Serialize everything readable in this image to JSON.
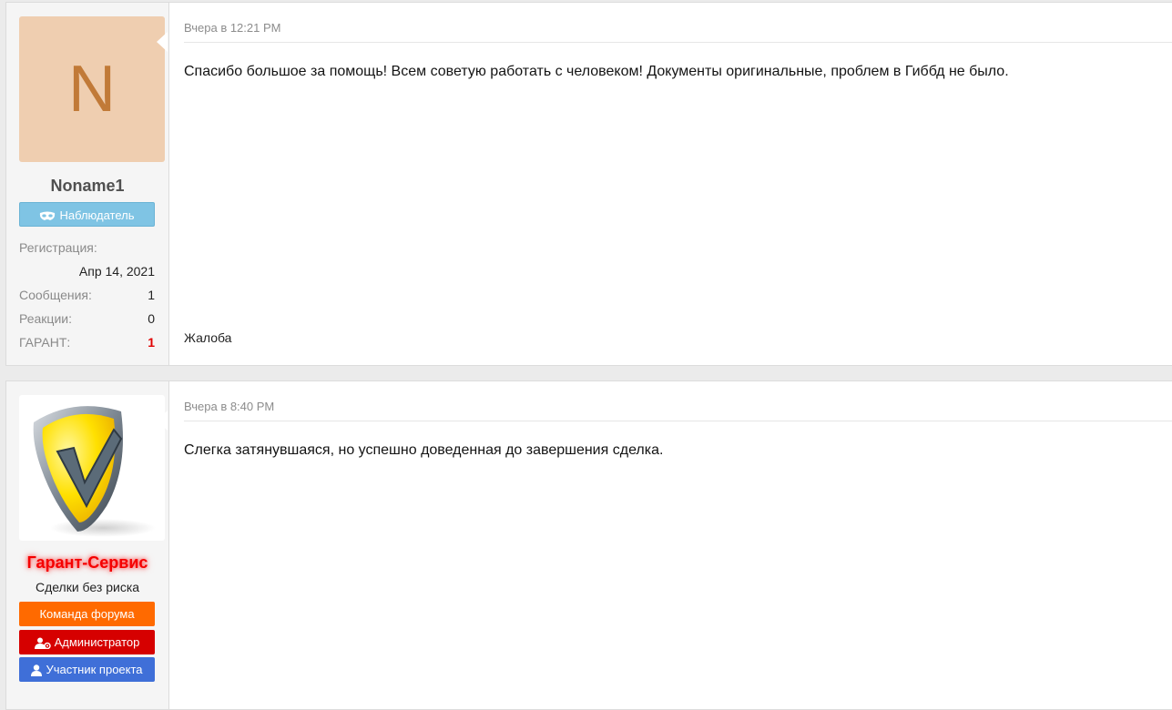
{
  "posts": [
    {
      "avatar_letter": "N",
      "username": "Noname1",
      "banners": [
        {
          "label": "Наблюдатель",
          "icon": "mask-icon",
          "color": "#7fc4e4"
        }
      ],
      "stats": {
        "reg_label": "Регистрация:",
        "reg_value": "Апр 14, 2021",
        "messages_label": "Сообщения:",
        "messages_value": "1",
        "reactions_label": "Реакции:",
        "reactions_value": "0",
        "guarant_label": "ГАРАНТ:",
        "guarant_value": "1"
      },
      "time": "Вчера в 12:21 PM",
      "message": "Спасибо большое за помощь! Всем советую работать с человеком! Документы оригинальные, проблем в Гиббд не было.",
      "report": "Жалоба"
    },
    {
      "avatar_icon": "shield-check-icon",
      "username": "Гарант-Сервис",
      "user_title": "Сделки без риска",
      "banners": [
        {
          "label": "Команда форума",
          "color": "#ff6a00"
        },
        {
          "label": "Администратор",
          "icon": "admin-user-icon",
          "color": "#d60000"
        },
        {
          "label": "Участник проекта",
          "icon": "user-icon",
          "color": "#3f6fd8"
        }
      ],
      "time": "Вчера в 8:40 PM",
      "message": "Слегка затянувшаяся, но успешно доведенная до завершения сделка."
    }
  ]
}
